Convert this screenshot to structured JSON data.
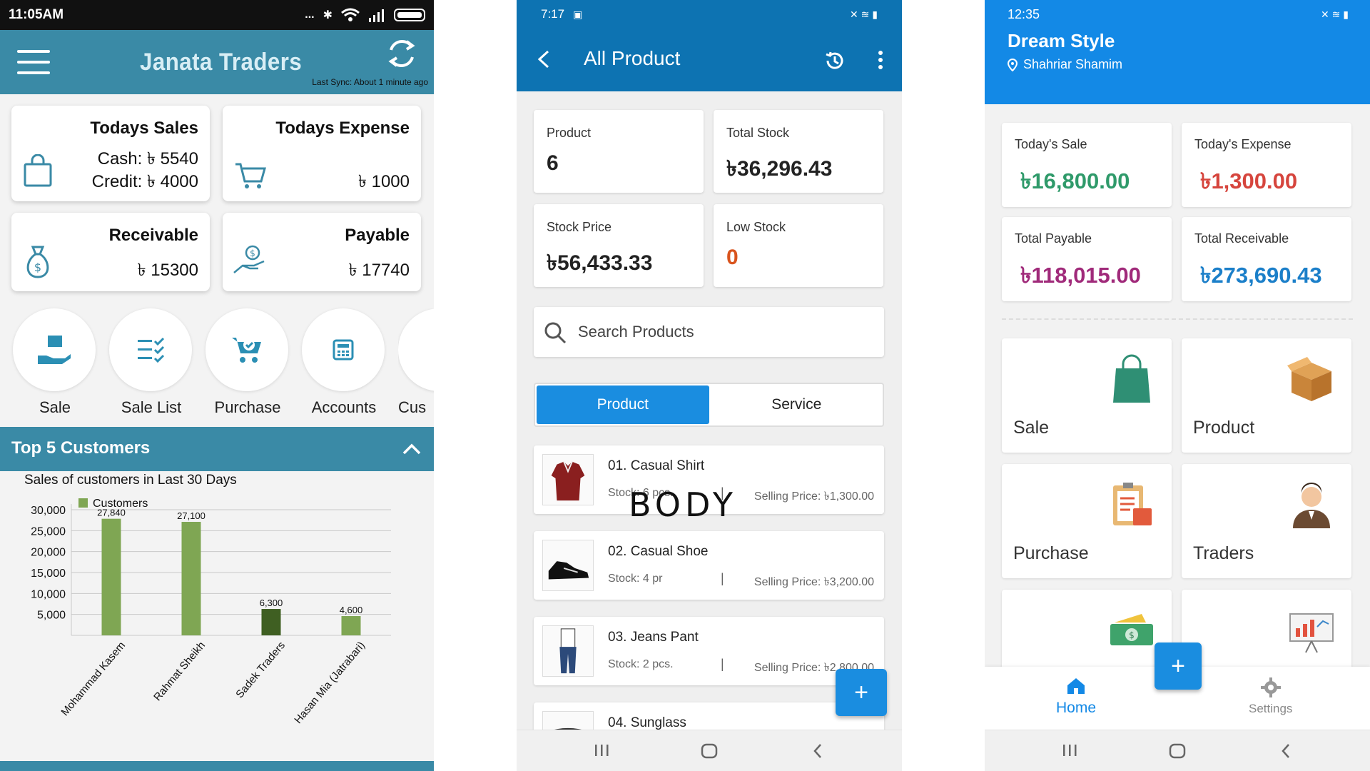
{
  "phone1": {
    "status": {
      "time": "11:05AM",
      "dots": "..."
    },
    "appbar": {
      "title": "Janata Traders",
      "sync_text": "Last Sync: About 1 minute ago"
    },
    "cards": {
      "sales": {
        "title": "Todays Sales",
        "line1": "Cash: ৳ 5540",
        "line2": "Credit: ৳ 4000",
        "icon": "shopping-bag-icon"
      },
      "expense": {
        "title": "Todays Expense",
        "value": "৳ 1000",
        "icon": "cart-icon"
      },
      "receivable": {
        "title": "Receivable",
        "value": "৳ 15300",
        "icon": "money-bag-icon"
      },
      "payable": {
        "title": "Payable",
        "value": "৳ 17740",
        "icon": "hand-coin-icon"
      }
    },
    "quick_actions": [
      {
        "label": "Sale",
        "icon": "hand-box-icon"
      },
      {
        "label": "Sale List",
        "icon": "checklist-icon"
      },
      {
        "label": "Purchase",
        "icon": "cart-check-icon"
      },
      {
        "label": "Accounts",
        "icon": "calculator-icon"
      },
      {
        "label": "Cus",
        "icon": "customer-icon"
      }
    ],
    "section": {
      "title": "Top 5 Customers",
      "subtitle": "Sales of customers in Last 30 Days"
    },
    "accent": "#3a8aa6"
  },
  "chart_data": {
    "type": "bar",
    "categories": [
      "Mohammad Kasem",
      "Rahmat Sheikh",
      "Sadek Traders",
      "Hasan Mia (Jatrabari)"
    ],
    "series": [
      {
        "name": "Customers",
        "values": [
          27840,
          27100,
          6300,
          4600
        ]
      }
    ],
    "data_labels": [
      "27,840",
      "27,100",
      "6,300",
      "4,600"
    ],
    "ytick_labels": [
      "5,000",
      "10,000",
      "15,000",
      "20,000",
      "25,000",
      "30,000"
    ],
    "yticks": [
      5000,
      10000,
      15000,
      20000,
      25000,
      30000
    ],
    "ylim": [
      0,
      30000
    ],
    "bar_colors": [
      "#7fa653",
      "#7fa653",
      "#3f5f22",
      "#7fa653"
    ],
    "legend_position": "top-left",
    "grid": true
  },
  "phone2": {
    "status": {
      "time": "7:17"
    },
    "appbar": {
      "title": "All Product"
    },
    "stats": [
      {
        "label": "Product",
        "value": "6",
        "color": "#222222"
      },
      {
        "label": "Total Stock",
        "value": "৳36,296.43",
        "color": "#222222"
      },
      {
        "label": "Stock Price",
        "value": "৳56,433.33",
        "color": "#222222"
      },
      {
        "label": "Low Stock",
        "value": "0",
        "color": "#d9541e"
      }
    ],
    "search": {
      "placeholder": "Search Products"
    },
    "tabs": [
      {
        "label": "Product",
        "active": true
      },
      {
        "label": "Service",
        "active": false
      }
    ],
    "products": [
      {
        "name": "01. Casual Shirt",
        "stock": "Stock: 6  pcs.",
        "price": "Selling Price: ৳1,300.00"
      },
      {
        "name": "02. Casual Shoe",
        "stock": "Stock: 4  pr",
        "price": "Selling Price: ৳3,200.00"
      },
      {
        "name": "03. Jeans Pant",
        "stock": "Stock: 2  pcs.",
        "price": "Selling Price: ৳2,800.00"
      },
      {
        "name": "04. Sunglass",
        "stock": "",
        "price": ""
      }
    ],
    "overlay_text": "BODY",
    "fab": "+",
    "accent": "#0d73b2"
  },
  "phone3": {
    "status": {
      "time": "12:35"
    },
    "shop_name": "Dream Style",
    "owner": "Shahriar Shamim",
    "kpis": [
      {
        "label": "Today's Sale",
        "value": "৳16,800.00",
        "color": "#2f9a6a"
      },
      {
        "label": "Today's Expense",
        "value": "৳1,300.00",
        "color": "#d6453d"
      },
      {
        "label": "Total Payable",
        "value": "৳118,015.00",
        "color": "#a02a7a"
      },
      {
        "label": "Total Receivable",
        "value": "৳273,690.43",
        "color": "#1b7fc9"
      }
    ],
    "tiles": [
      {
        "label": "Sale",
        "icon": "shopping-bag-icon"
      },
      {
        "label": "Product",
        "icon": "box-icon"
      },
      {
        "label": "Purchase",
        "icon": "clipboard-icon"
      },
      {
        "label": "Traders",
        "icon": "person-icon"
      },
      {
        "label": "",
        "icon": "money-icon"
      },
      {
        "label": "",
        "icon": "presentation-chart-icon"
      }
    ],
    "nav": {
      "home": "Home",
      "settings": "Settings"
    },
    "fab": "+",
    "accent": "#1389e6"
  }
}
